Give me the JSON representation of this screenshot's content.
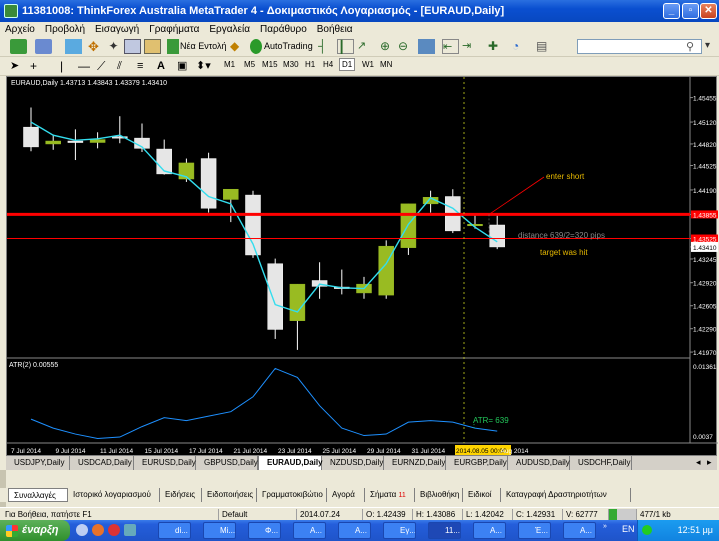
{
  "window": {
    "title": "11381008: ThinkForex Australia MetaTrader 4 - Δοκιμαστικός Λογαριασμός - [EURAUD,Daily]"
  },
  "menu": [
    "Αρχείο",
    "Προβολή",
    "Εισαγωγή",
    "Γραφήματα",
    "Εργαλεία",
    "Παράθυρο",
    "Βοήθεια"
  ],
  "toolbar": {
    "new_order": "Νέα Εντολή",
    "autotrading": "AutoTrading"
  },
  "timeframes": [
    "M1",
    "M5",
    "M15",
    "M30",
    "H1",
    "H4",
    "D1",
    "W1",
    "MN"
  ],
  "active_timeframe": "D1",
  "chart": {
    "header": "EURAUD,Daily  1.43713 1.43843 1.43379 1.43410",
    "price_labels": [
      "1.45455",
      "1.45120",
      "1.44820",
      "1.44525",
      "1.44190",
      "1.43855",
      "1.43525",
      "1.43410",
      "1.43245",
      "1.42920",
      "1.42605",
      "1.42290",
      "1.41970"
    ],
    "date_labels": [
      "7 Jul 2014",
      "9 Jul 2014",
      "11 Jul 2014",
      "15 Jul 2014",
      "17 Jul 2014",
      "21 Jul 2014",
      "23 Jul 2014",
      "25 Jul 2014",
      "29 Jul 2014",
      "31 Jul 2014",
      "2014.08.05 00:00",
      "Aug 2014"
    ],
    "annotations": {
      "enter": "enter short",
      "distance": "distance 639/2=320 pips",
      "target": "target was hit",
      "atr_value": "ATR= 639"
    },
    "indicator": {
      "label": "ATR(2) 0.00555",
      "max": "0.01361",
      "min": "0.0037"
    },
    "candles": [
      {
        "o": 1.4505,
        "h": 1.4532,
        "l": 1.4472,
        "c": 1.4478
      },
      {
        "o": 1.4482,
        "h": 1.4495,
        "l": 1.4474,
        "c": 1.4486
      },
      {
        "o": 1.4486,
        "h": 1.4502,
        "l": 1.446,
        "c": 1.4484
      },
      {
        "o": 1.4484,
        "h": 1.4498,
        "l": 1.4476,
        "c": 1.4488
      },
      {
        "o": 1.4492,
        "h": 1.452,
        "l": 1.4483,
        "c": 1.4491
      },
      {
        "o": 1.449,
        "h": 1.451,
        "l": 1.4471,
        "c": 1.4476
      },
      {
        "o": 1.4475,
        "h": 1.4488,
        "l": 1.444,
        "c": 1.4441
      },
      {
        "o": 1.4434,
        "h": 1.4462,
        "l": 1.443,
        "c": 1.4456
      },
      {
        "o": 1.4462,
        "h": 1.447,
        "l": 1.4388,
        "c": 1.4394
      },
      {
        "o": 1.4406,
        "h": 1.442,
        "l": 1.4375,
        "c": 1.442
      },
      {
        "o": 1.4412,
        "h": 1.4418,
        "l": 1.4326,
        "c": 1.433
      },
      {
        "o": 1.4318,
        "h": 1.4325,
        "l": 1.4215,
        "c": 1.4228
      },
      {
        "o": 1.424,
        "h": 1.429,
        "l": 1.42,
        "c": 1.429
      },
      {
        "o": 1.4295,
        "h": 1.432,
        "l": 1.427,
        "c": 1.4287
      },
      {
        "o": 1.4286,
        "h": 1.431,
        "l": 1.4276,
        "c": 1.4284
      },
      {
        "o": 1.4278,
        "h": 1.43,
        "l": 1.427,
        "c": 1.429
      },
      {
        "o": 1.4275,
        "h": 1.435,
        "l": 1.427,
        "c": 1.4342
      },
      {
        "o": 1.434,
        "h": 1.44,
        "l": 1.433,
        "c": 1.44
      },
      {
        "o": 1.44,
        "h": 1.4418,
        "l": 1.4388,
        "c": 1.4409
      },
      {
        "o": 1.441,
        "h": 1.442,
        "l": 1.436,
        "c": 1.4363
      },
      {
        "o": 1.437,
        "h": 1.4385,
        "l": 1.4366,
        "c": 1.4372
      },
      {
        "o": 1.4371,
        "h": 1.4384,
        "l": 1.4338,
        "c": 1.4341
      }
    ],
    "ma": [
      1.4512,
      1.4494,
      1.4487,
      1.4489,
      1.4494,
      1.4478,
      1.4445,
      1.4437,
      1.441,
      1.44,
      1.4345,
      1.4262,
      1.4252,
      1.429,
      1.4285,
      1.4284,
      1.4318,
      1.4372,
      1.4408,
      1.4394,
      1.4368,
      1.4348
    ],
    "atr": [
      0.0062,
      0.005,
      0.0042,
      0.0036,
      0.0038,
      0.0052,
      0.0064,
      0.006,
      0.0066,
      0.0072,
      0.0092,
      0.013,
      0.0118,
      0.008,
      0.005,
      0.004,
      0.0042,
      0.0058,
      0.006,
      0.0058,
      0.005,
      0.0046
    ],
    "colors": {
      "bull": "#99bb22",
      "bear": "#e6e6e6",
      "ma": "#33ddee",
      "atr": "#1e90ff",
      "hline": "#ff0000"
    }
  },
  "symbol_tabs": [
    "USDJPY,Daily",
    "USDCAD,Daily",
    "EURUSD,Daily",
    "GBPUSD,Daily",
    "EURAUD,Daily",
    "NZDUSD,Daily",
    "EURNZD,Daily",
    "EURGBP,Daily",
    "AUDUSD,Daily",
    "USDCHF,Daily"
  ],
  "active_symbol_tab": "EURAUD,Daily",
  "terminal_tabs": [
    "Συναλλαγές",
    "Ιστορικό λογαριασμού",
    "Ειδήσεις",
    "Ειδοποιήσεις",
    "Γραμματοκιβώτιο",
    "Αγορά",
    "Σήματα",
    "Βιβλιοθήκη",
    "Ειδικοί",
    "Καταγραφή Δραστηριοτήτων"
  ],
  "signals_badge": "11",
  "status": {
    "help": "Για Βοήθεια, πατήστε F1",
    "profile": "Default",
    "date": "2014.07.24 00:00",
    "open": "O: 1.42439",
    "high": "H: 1.43086",
    "low": "L: 1.42042",
    "close": "C: 1.42931",
    "volume": "V: 62777",
    "traffic": "477/1 kb"
  },
  "taskbar": {
    "start": "έναρξη",
    "buttons": [
      "di...",
      "Mi...",
      "Φ...",
      "A...",
      "A...",
      "Εγ...",
      "11...",
      "A...",
      "Έ...",
      "A..."
    ],
    "lang": "EN",
    "clock": "12:51 μμ"
  }
}
